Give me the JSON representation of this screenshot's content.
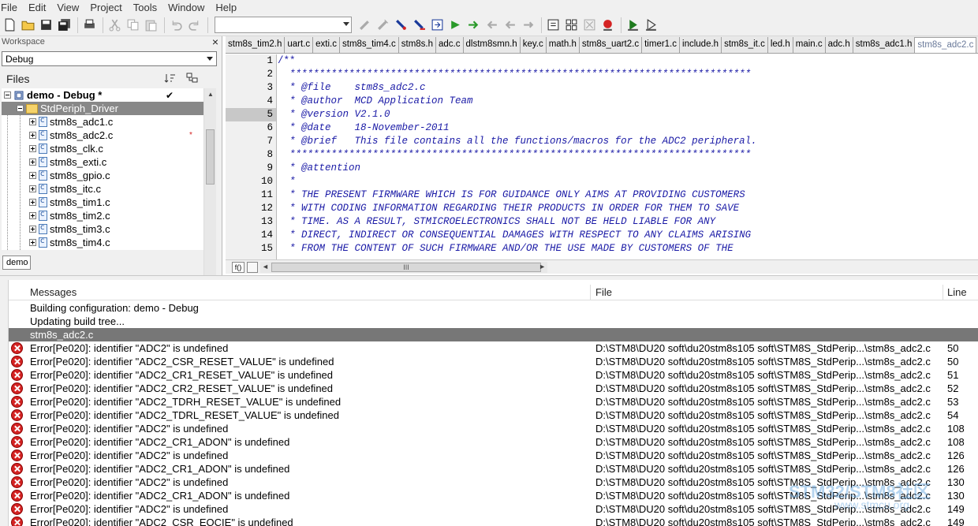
{
  "menu": [
    "File",
    "Edit",
    "View",
    "Project",
    "Tools",
    "Window",
    "Help"
  ],
  "toolbar": {
    "icons": [
      "new-file",
      "open-file",
      "save",
      "save-all",
      "print",
      "cut",
      "copy",
      "paste",
      "undo",
      "redo"
    ],
    "combo_value": "",
    "icons_right": [
      "find",
      "find-next",
      "bookmark",
      "bookmark-next",
      "bookmark-toggle",
      "go-to",
      "compile",
      "make",
      "stop-build",
      "breakpoint",
      "debug",
      "download-debug"
    ]
  },
  "workspace": {
    "title": "Workspace",
    "close": "×",
    "config": "Debug",
    "files_label": "Files",
    "project": "demo - Debug *",
    "project_check": "✔",
    "folder": "StdPeriph_Driver",
    "files": [
      "stm8s_adc1.c",
      "stm8s_adc2.c",
      "stm8s_clk.c",
      "stm8s_exti.c",
      "stm8s_gpio.c",
      "stm8s_itc.c",
      "stm8s_tim1.c",
      "stm8s_tim2.c",
      "stm8s_tim3.c",
      "stm8s_tim4.c"
    ],
    "modified_marker": "*",
    "tab": "demo"
  },
  "editor": {
    "tabs": [
      "stm8s_tim2.h",
      "uart.c",
      "exti.c",
      "stm8s_tim4.c",
      "stm8s.h",
      "adc.c",
      "dlstm8smn.h",
      "key.c",
      "math.h",
      "stm8s_uart2.c",
      "timer1.c",
      "include.h",
      "stm8s_it.c",
      "led.h",
      "main.c",
      "adc.h",
      "stm8s_adc1.h",
      "stm8s_adc2.c"
    ],
    "active_tab": "stm8s_adc2.c",
    "current_line": "5",
    "line_numbers": [
      "1",
      "2",
      "3",
      "4",
      "5",
      "6",
      "7",
      "8",
      "9",
      "10",
      "11",
      "12",
      "13",
      "14",
      "15"
    ],
    "lines": [
      "/**",
      "  ******************************************************************************",
      "  * @file    stm8s_adc2.c",
      "  * @author  MCD Application Team",
      "  * @version V2.1.0",
      "  * @date    18-November-2011",
      "  * @brief   This file contains all the functions/macros for the ADC2 peripheral.",
      "  ******************************************************************************",
      "  * @attention",
      "  *",
      "  * THE PRESENT FIRMWARE WHICH IS FOR GUIDANCE ONLY AIMS AT PROVIDING CUSTOMERS",
      "  * WITH CODING INFORMATION REGARDING THEIR PRODUCTS IN ORDER FOR THEM TO SAVE",
      "  * TIME. AS A RESULT, STMICROELECTRONICS SHALL NOT BE HELD LIABLE FOR ANY",
      "  * DIRECT, INDIRECT OR CONSEQUENTIAL DAMAGES WITH RESPECT TO ANY CLAIMS ARISING",
      "  * FROM THE CONTENT OF SUCH FIRMWARE AND/OR THE USE MADE BY CUSTOMERS OF THE"
    ],
    "scroll_grip": "III",
    "fo_label": "f()"
  },
  "messages": {
    "headers": {
      "messages": "Messages",
      "file": "File",
      "line": "Line"
    },
    "info": [
      "Building configuration: demo - Debug",
      "Updating build tree..."
    ],
    "selected": "stm8s_adc2.c",
    "errors": [
      {
        "text": "Error[Pe020]: identifier \"ADC2\" is undefined",
        "file": "D:\\STM8\\DU20 soft\\du20stm8s105  soft\\STM8S_StdPerip...\\stm8s_adc2.c",
        "line": "50"
      },
      {
        "text": "Error[Pe020]: identifier \"ADC2_CSR_RESET_VALUE\" is undefined",
        "file": "D:\\STM8\\DU20 soft\\du20stm8s105  soft\\STM8S_StdPerip...\\stm8s_adc2.c",
        "line": "50"
      },
      {
        "text": "Error[Pe020]: identifier \"ADC2_CR1_RESET_VALUE\" is undefined",
        "file": "D:\\STM8\\DU20 soft\\du20stm8s105  soft\\STM8S_StdPerip...\\stm8s_adc2.c",
        "line": "51"
      },
      {
        "text": "Error[Pe020]: identifier \"ADC2_CR2_RESET_VALUE\" is undefined",
        "file": "D:\\STM8\\DU20 soft\\du20stm8s105  soft\\STM8S_StdPerip...\\stm8s_adc2.c",
        "line": "52"
      },
      {
        "text": "Error[Pe020]: identifier \"ADC2_TDRH_RESET_VALUE\" is undefined",
        "file": "D:\\STM8\\DU20 soft\\du20stm8s105  soft\\STM8S_StdPerip...\\stm8s_adc2.c",
        "line": "53"
      },
      {
        "text": "Error[Pe020]: identifier \"ADC2_TDRL_RESET_VALUE\" is undefined",
        "file": "D:\\STM8\\DU20 soft\\du20stm8s105  soft\\STM8S_StdPerip...\\stm8s_adc2.c",
        "line": "54"
      },
      {
        "text": "Error[Pe020]: identifier \"ADC2\" is undefined",
        "file": "D:\\STM8\\DU20 soft\\du20stm8s105  soft\\STM8S_StdPerip...\\stm8s_adc2.c",
        "line": "108"
      },
      {
        "text": "Error[Pe020]: identifier \"ADC2_CR1_ADON\" is undefined",
        "file": "D:\\STM8\\DU20 soft\\du20stm8s105  soft\\STM8S_StdPerip...\\stm8s_adc2.c",
        "line": "108"
      },
      {
        "text": "Error[Pe020]: identifier \"ADC2\" is undefined",
        "file": "D:\\STM8\\DU20 soft\\du20stm8s105  soft\\STM8S_StdPerip...\\stm8s_adc2.c",
        "line": "126"
      },
      {
        "text": "Error[Pe020]: identifier \"ADC2_CR1_ADON\" is undefined",
        "file": "D:\\STM8\\DU20 soft\\du20stm8s105  soft\\STM8S_StdPerip...\\stm8s_adc2.c",
        "line": "126"
      },
      {
        "text": "Error[Pe020]: identifier \"ADC2\" is undefined",
        "file": "D:\\STM8\\DU20 soft\\du20stm8s105  soft\\STM8S_StdPerip...\\stm8s_adc2.c",
        "line": "130"
      },
      {
        "text": "Error[Pe020]: identifier \"ADC2_CR1_ADON\" is undefined",
        "file": "D:\\STM8\\DU20 soft\\du20stm8s105  soft\\STM8S_StdPerip...\\stm8s_adc2.c",
        "line": "130"
      },
      {
        "text": "Error[Pe020]: identifier \"ADC2\" is undefined",
        "file": "D:\\STM8\\DU20 soft\\du20stm8s105  soft\\STM8S_StdPerip...\\stm8s_adc2.c",
        "line": "149"
      },
      {
        "text": "Error[Pe020]: identifier \"ADC2_CSR_EOCIE\" is undefined",
        "file": "D:\\STM8\\DU20 soft\\du20stm8s105  soft\\STM8S_StdPerip...\\stm8s_adc2.c",
        "line": "149"
      }
    ]
  },
  "watermark": {
    "text": "STM32/STM8社区",
    "sub": "www.stmcu.org"
  },
  "colors": {
    "code": "#1a1aa6",
    "error": "#d42323",
    "selection": "#777777"
  }
}
